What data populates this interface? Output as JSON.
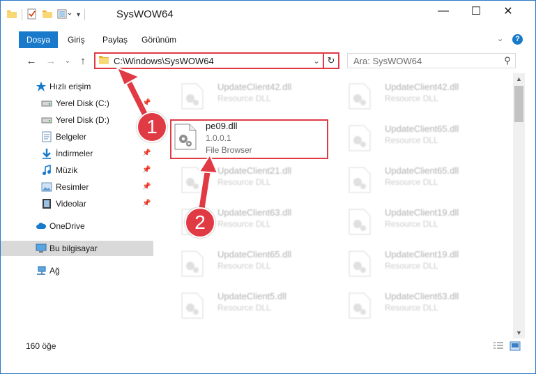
{
  "window": {
    "title": "SysWOW64"
  },
  "titlebar": {
    "minimize": "—",
    "maximize": "☐",
    "close": "✕"
  },
  "ribbon": {
    "tabs": [
      {
        "label": "Dosya"
      },
      {
        "label": "Giriş"
      },
      {
        "label": "Paylaş"
      },
      {
        "label": "Görünüm"
      }
    ]
  },
  "nav": {
    "address": "C:\\Windows\\SysWOW64",
    "search_placeholder": "Ara: SysWOW64"
  },
  "sidebar": {
    "items": [
      {
        "label": "Hızlı erişim",
        "icon": "star-icon",
        "pinned": false
      },
      {
        "label": "Yerel Disk (C:)",
        "icon": "drive-icon",
        "pinned": true
      },
      {
        "label": "Yerel Disk (D:)",
        "icon": "drive-icon",
        "pinned": false
      },
      {
        "label": "Belgeler",
        "icon": "documents-icon",
        "pinned": true
      },
      {
        "label": "İndirmeler",
        "icon": "download-icon",
        "pinned": true
      },
      {
        "label": "Müzik",
        "icon": "music-icon",
        "pinned": true
      },
      {
        "label": "Resimler",
        "icon": "pictures-icon",
        "pinned": true
      },
      {
        "label": "Videolar",
        "icon": "video-icon",
        "pinned": true
      },
      {
        "label": "OneDrive",
        "icon": "cloud-icon",
        "pinned": false
      },
      {
        "label": "Bu bilgisayar",
        "icon": "computer-icon",
        "pinned": false
      },
      {
        "label": "Ağ",
        "icon": "network-icon",
        "pinned": false
      }
    ]
  },
  "files": {
    "highlighted": {
      "name": "pe09.dll",
      "version": "1.0.0.1",
      "description": "File Browser"
    },
    "left_column": [
      {
        "name": "UpdateClient42.dll",
        "type": "Resource DLL"
      },
      {
        "name": "UpdateClient21.dll",
        "type": "Resource DLL"
      },
      {
        "name": "UpdateClient63.dll",
        "type": "Resource DLL"
      },
      {
        "name": "UpdateClient65.dll",
        "type": "Resource DLL"
      },
      {
        "name": "UpdateClient5.dll",
        "type": "Resource DLL"
      }
    ],
    "right_column": [
      {
        "name": "UpdateClient42.dll",
        "type": "Resource DLL"
      },
      {
        "name": "UpdateClient65.dll",
        "type": "Resource DLL"
      },
      {
        "name": "UpdateClient65.dll",
        "type": "Resource DLL"
      },
      {
        "name": "UpdateClient19.dll",
        "type": "Resource DLL"
      },
      {
        "name": "UpdateClient19.dll",
        "type": "Resource DLL"
      },
      {
        "name": "UpdateClient63.dll",
        "type": "Resource DLL"
      }
    ]
  },
  "status": {
    "item_count": "160 öğe"
  },
  "annotations": {
    "step1": "1",
    "step2": "2"
  },
  "colors": {
    "accent": "#1979ca",
    "annotation": "#e03a44",
    "selected": "#d9d9d9"
  }
}
